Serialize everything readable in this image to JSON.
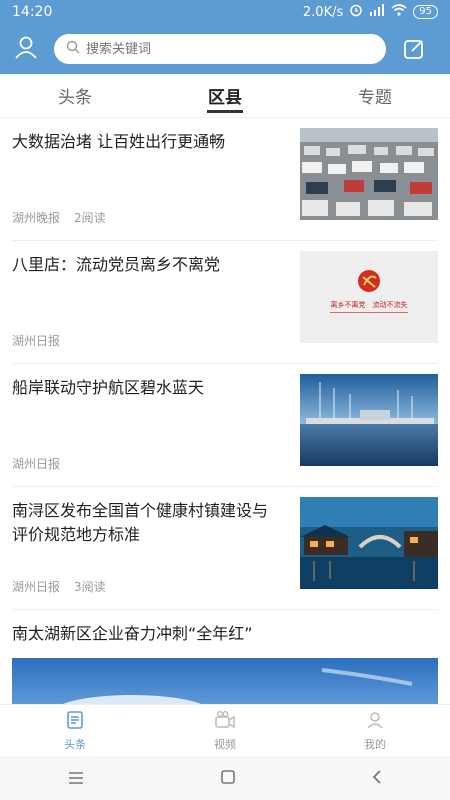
{
  "status_bar": {
    "time": "14:20",
    "speed": "2.0K/s",
    "battery": "95"
  },
  "header": {
    "search_placeholder": "搜索关键词"
  },
  "tabs": [
    {
      "label": "头条"
    },
    {
      "label": "区县"
    },
    {
      "label": "专题"
    }
  ],
  "feed": {
    "items": [
      {
        "title": "大数据治堵 让百姓出行更通畅",
        "source": "湖州晚报",
        "reads": "2阅读",
        "image": "traffic-jam-photo"
      },
      {
        "title": "八里店：流动党员离乡不离党",
        "source": "湖州日报",
        "reads": "",
        "image": "party-badge-image",
        "image_text": "离乡不离党　流动不流失"
      },
      {
        "title": "船岸联动守护航区碧水蓝天",
        "source": "湖州日报",
        "reads": "",
        "image": "harbor-boats-photo"
      },
      {
        "title": "南浔区发布全国首个健康村镇建设与评价规范地方标准",
        "source": "湖州日报",
        "reads": "3阅读",
        "image": "water-town-night-photo"
      }
    ],
    "big_item": {
      "title": "南太湖新区企业奋力冲刺“全年红”",
      "image": "blue-sky-photo"
    }
  },
  "bottom_nav": [
    {
      "label": "头条",
      "icon": "news-icon",
      "active": true
    },
    {
      "label": "视频",
      "icon": "video-icon",
      "active": false
    },
    {
      "label": "我的",
      "icon": "user-icon",
      "active": false
    }
  ],
  "colors": {
    "brand": "#5d9bd3",
    "text": "#222222",
    "meta": "#9a9a9a"
  }
}
